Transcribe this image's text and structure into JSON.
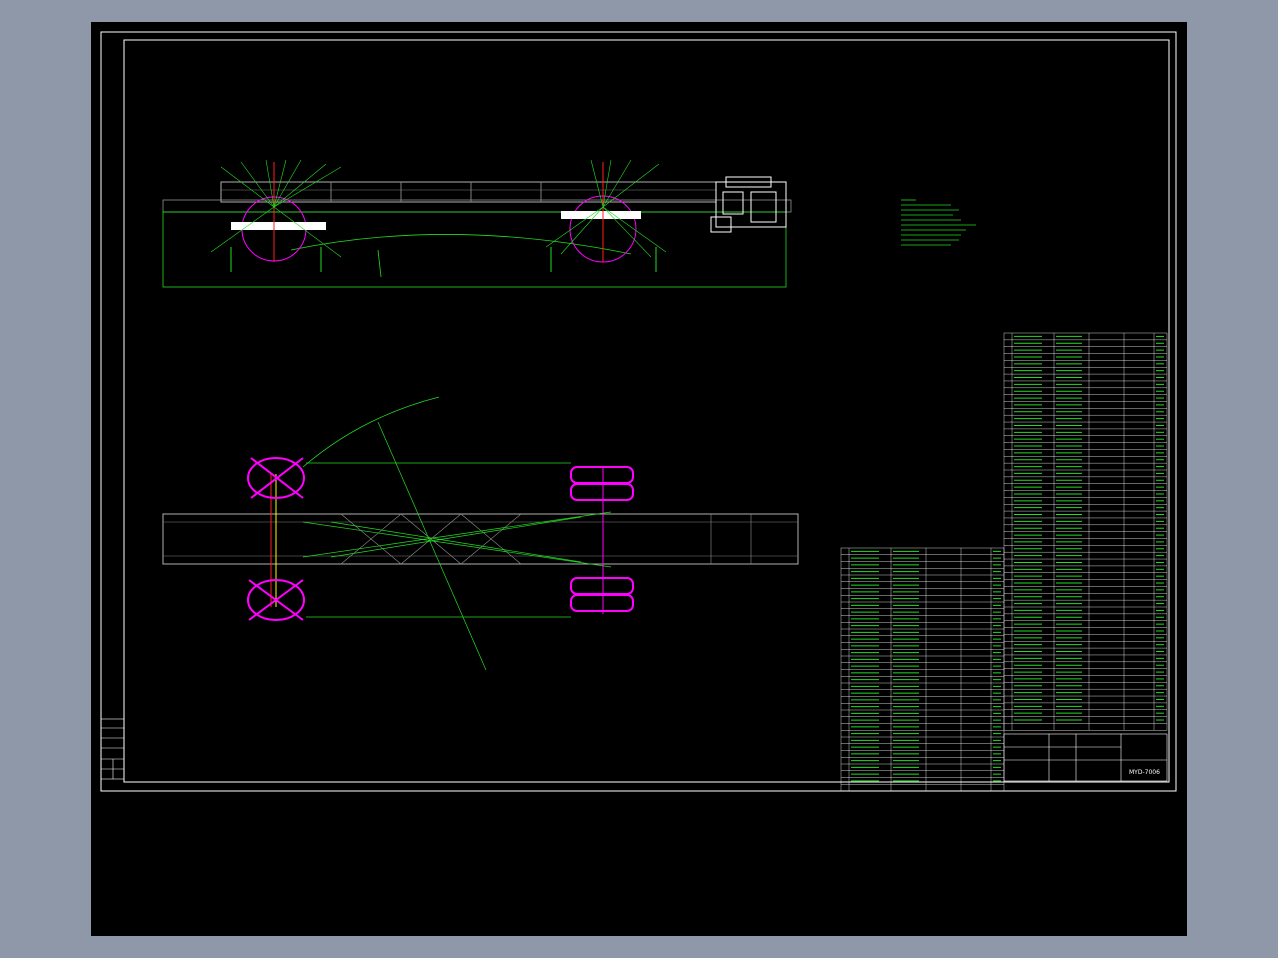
{
  "drawing": {
    "background": "#000000",
    "page_background": "#8e98a8",
    "colors": {
      "frame": "#ffffff",
      "dimension": "#22dd22",
      "wheel": "#ff00ff",
      "accent_red": "#ff2020",
      "accent_yellow": "#ffff00",
      "accent_blue": "#3040ff",
      "table_text": "#7cfc7c"
    }
  },
  "title_block": {
    "drawing_number": "MYD-7006"
  },
  "parts_list": {
    "right_rows": 58,
    "left_rows": 36
  }
}
